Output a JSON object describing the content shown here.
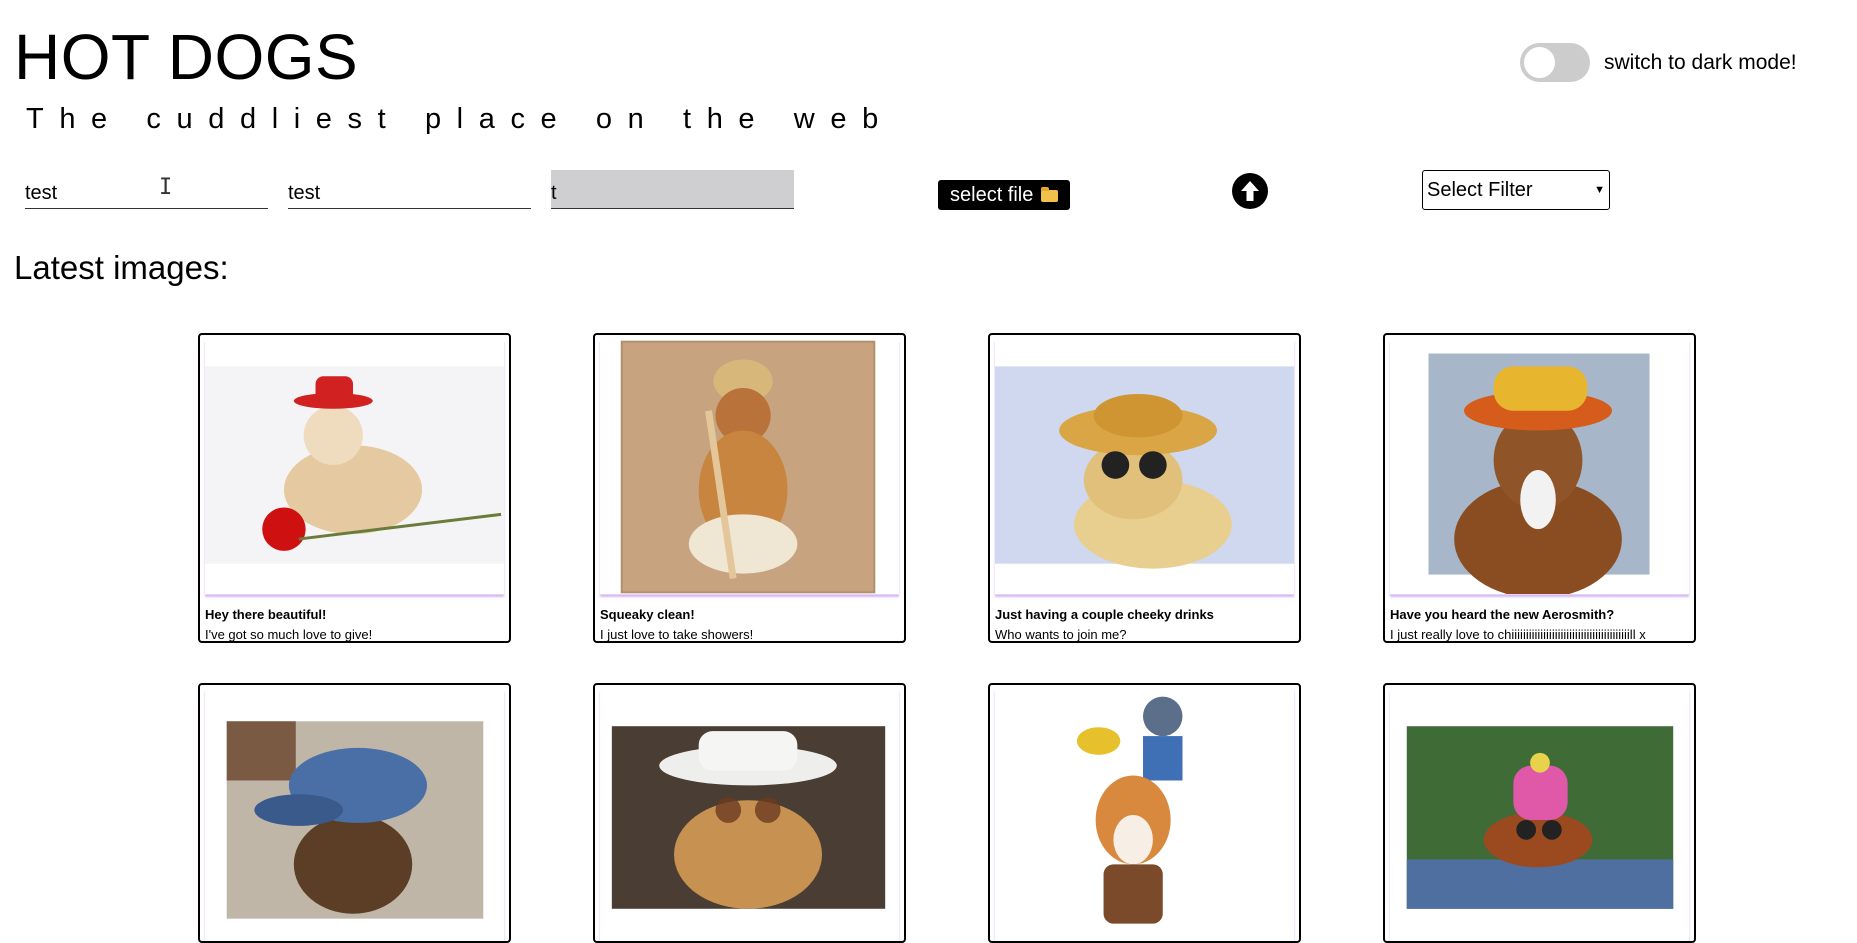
{
  "header": {
    "title": "HOT DOGS",
    "subtitle": "The cuddliest place on the web",
    "dark_mode_label": "switch to dark mode!"
  },
  "form": {
    "field1_value": "test",
    "field2_value": "test",
    "field3_value": "t",
    "select_file_label": "select file",
    "upload_icon": "arrow-up-circle-icon",
    "filter_selected": "Select Filter"
  },
  "section": {
    "title": "Latest images:"
  },
  "cards": [
    {
      "title": "Hey there beautiful!",
      "text": "I've got so much love to give!",
      "image": "dog in red cowboy hat with rose"
    },
    {
      "title": "Squeaky clean!",
      "text": "I just love to take showers!",
      "image": "dog in shower cap with towel and brush"
    },
    {
      "title": "Just having a couple cheeky drinks",
      "text": "Who wants to join me?",
      "image": "dog with straw hat and sunglasses"
    },
    {
      "title": "Have you heard the new Aerosmith?",
      "text": "I just really love to chiiiiiiiiiiiiiiiiiiiiiiiiiiiiiiiiiiiiiiiiill x",
      "image": "dog in yellow bucket hat"
    },
    {
      "title": "",
      "text": "",
      "image": "dog in blue cap in car"
    },
    {
      "title": "",
      "text": "",
      "image": "dog in white cowboy hat with sunglasses"
    },
    {
      "title": "",
      "text": "",
      "image": "corgi with cowboy rider costume"
    },
    {
      "title": "",
      "text": "",
      "image": "puppy in pink beanie with goggles"
    }
  ],
  "colors": {
    "toggle_off": "#cccccc",
    "caption_shadow": "#d6b6f1",
    "active_field": "#cfcfd2"
  }
}
